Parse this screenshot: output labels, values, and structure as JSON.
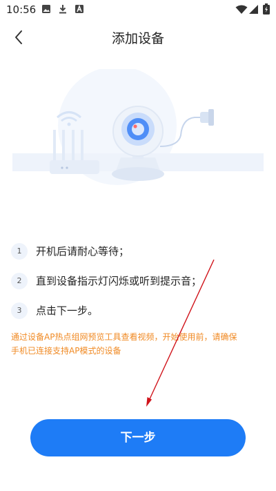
{
  "status_bar": {
    "time": "10:56",
    "left_icons": [
      "image-icon",
      "download-icon",
      "a-box-icon"
    ],
    "right_icons": [
      "wifi-icon",
      "signal-icon",
      "battery-icon"
    ]
  },
  "header": {
    "title": "添加设备",
    "back_icon": "chevron-left-icon"
  },
  "illustration": {
    "icons": [
      "router-icon",
      "wifi-signal-icon",
      "camera-icon",
      "power-plug-icon"
    ]
  },
  "steps": [
    {
      "number": "1",
      "text": "开机后请耐心等待；"
    },
    {
      "number": "2",
      "text": "直到设备指示灯闪烁或听到提示音；"
    },
    {
      "number": "3",
      "text": "点击下一步。"
    }
  ],
  "notice": {
    "line1": "通过设备AP热点组网预览工具查看视频，开始使用前，请确保",
    "line2": "手机已连接支持AP模式的设备"
  },
  "footer": {
    "next_label": "下一步"
  },
  "colors": {
    "primary": "#1e7cf6",
    "notice": "#f08a24",
    "annotation": "#d0131a"
  }
}
